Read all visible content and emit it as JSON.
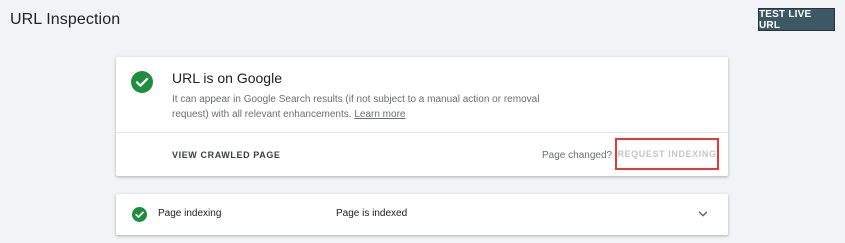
{
  "header": {
    "title": "URL Inspection",
    "test_live_url_label": "TEST LIVE URL"
  },
  "status_card": {
    "title": "URL is on Google",
    "description": "It can appear in Google Search results (if not subject to a manual action or removal request) with all relevant enhancements.",
    "learn_more": "Learn more",
    "view_crawled_label": "VIEW CRAWLED PAGE",
    "page_changed_label": "Page changed?",
    "request_indexing_label": "REQUEST INDEXING",
    "status_icon": "check-circle-icon",
    "status_color": "#1e8e3e",
    "highlight_color": "#e53935"
  },
  "indexing_card": {
    "label": "Page indexing",
    "value": "Page is indexed",
    "status_icon": "check-circle-icon",
    "expand_icon": "chevron-down-icon"
  },
  "colors": {
    "background": "#f1f3f6",
    "button_bg": "#3c5865"
  }
}
